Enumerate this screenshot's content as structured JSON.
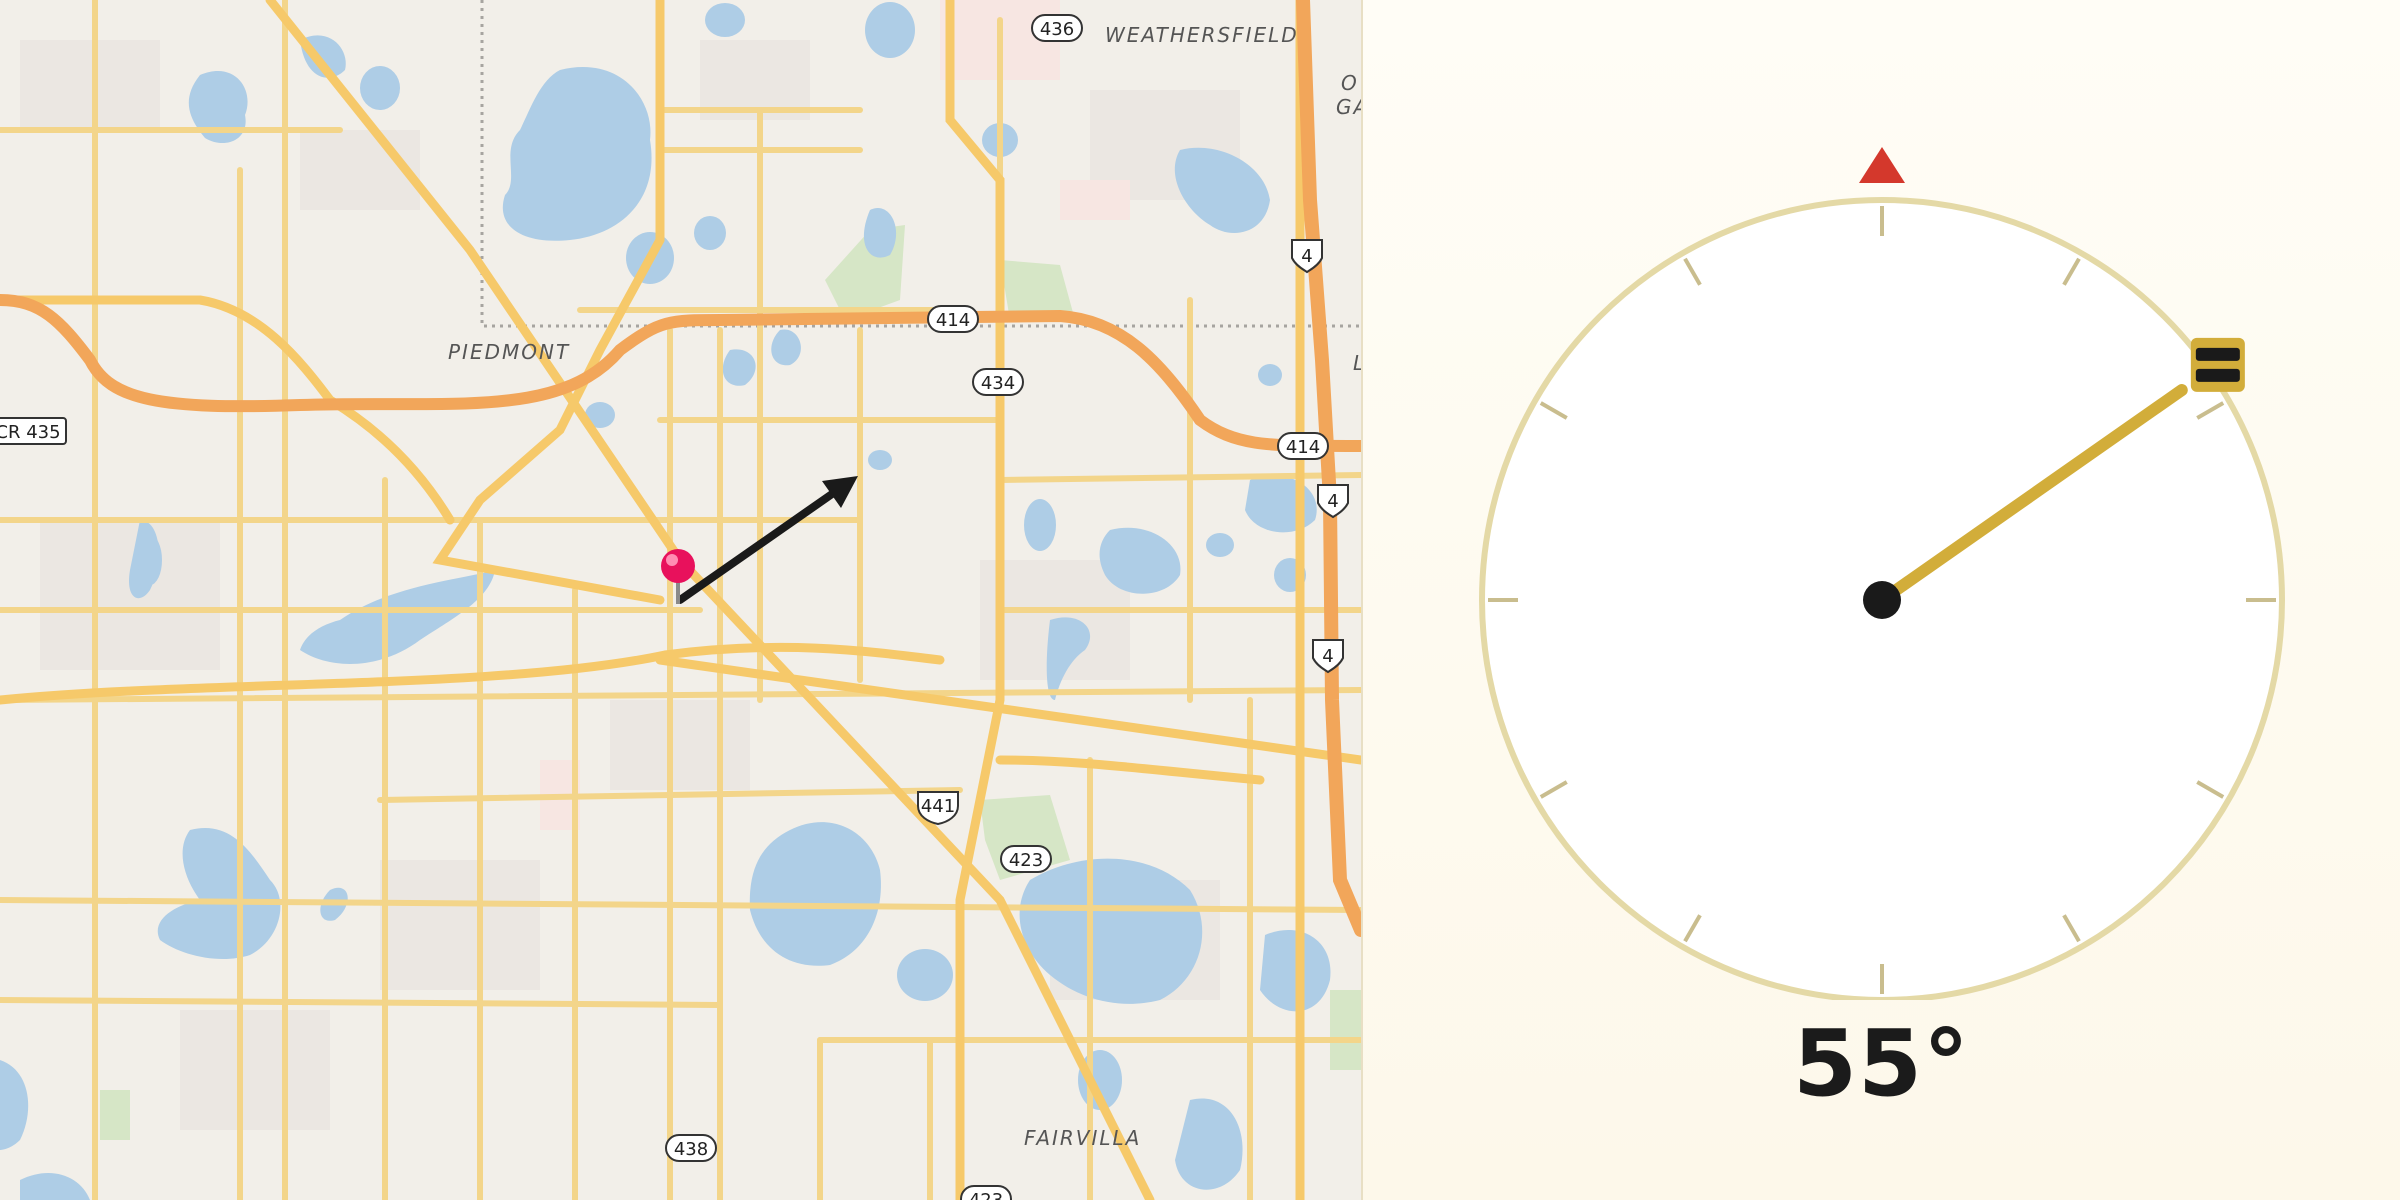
{
  "map": {
    "place_labels": {
      "weathersfield": "WEATHERSFIELD",
      "piedmont": "PIEDMONT",
      "fairvilla": "FAIRVILLA",
      "edge_top_right_1": "O",
      "edge_top_right_2": "GA",
      "edge_mid_right": "L"
    },
    "route_shields": {
      "r436": "436",
      "r414_a": "414",
      "r434": "434",
      "r414_b": "414",
      "i4_a": "4",
      "i4_b": "4",
      "i4_c": "4",
      "cr435": "CR 435",
      "us441": "441",
      "r423": "423",
      "r438": "438",
      "r423_bottom": "423"
    },
    "pin_icon": "map-pin-icon",
    "direction_arrow_icon": "direction-arrow-icon"
  },
  "compass": {
    "heading_deg": 55,
    "heading_text": "55°",
    "north_marker_icon": "north-triangle-icon",
    "needle_handle_icon": "drag-handle-icon",
    "colors": {
      "ring": "#e4d9a6",
      "needle": "#d2ad3a",
      "north": "#d4382c",
      "hub": "#1a1a1a"
    }
  }
}
